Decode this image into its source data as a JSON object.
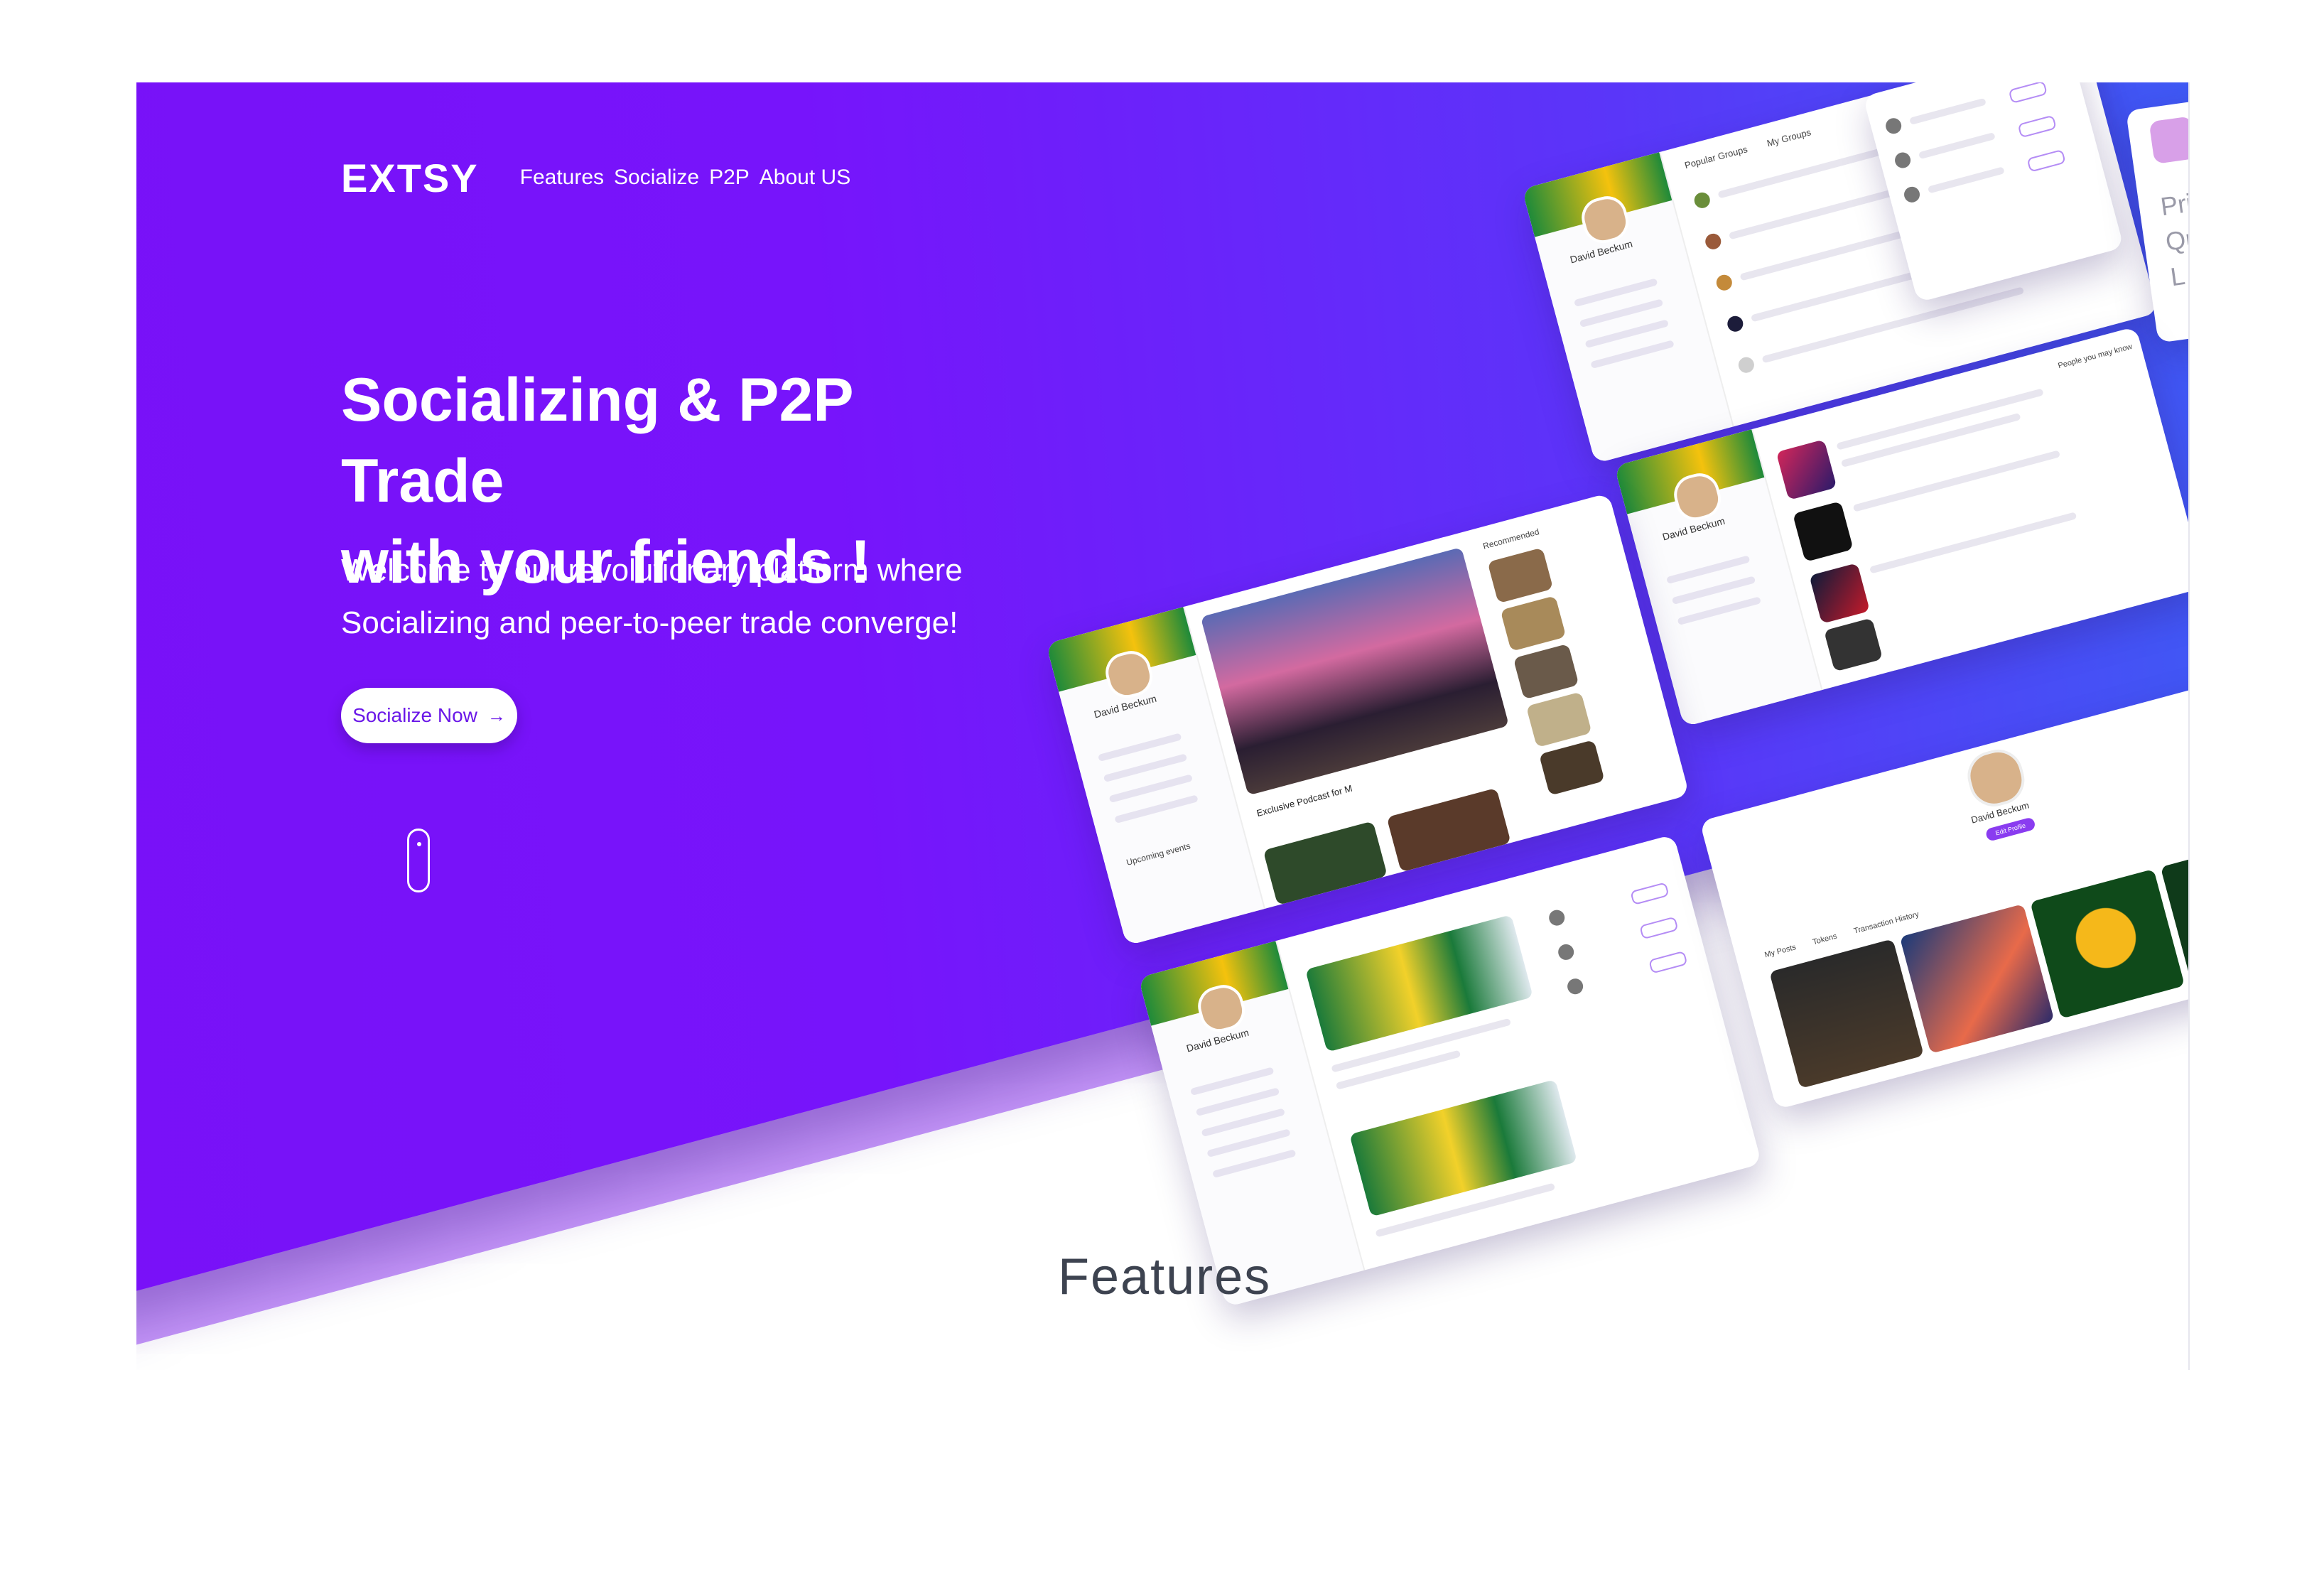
{
  "brand": {
    "logo": "EXTSY"
  },
  "nav": {
    "items": [
      "Features",
      "Socialize",
      "P2P",
      "About US"
    ]
  },
  "hero": {
    "title_line1": "Socializing & P2P Trade",
    "title_line2": "with your friends !",
    "subtitle_line1": "Welcome to our revolutionary platform where",
    "subtitle_line2": "Socializing and peer-to-peer trade converge!",
    "cta_label": "Socialize Now",
    "cta_icon": "arrow-right-icon"
  },
  "mockups": {
    "profile_name": "David Beckum",
    "featured_label": "Exclusive Podcast for M",
    "recommended_label": "Recommended",
    "groups_tabs": [
      "Popular Groups",
      "My Groups"
    ],
    "people_label": "People you may know",
    "upcoming_label": "Upcoming events",
    "edit_profile": "Edit Profile",
    "profile_tabs": [
      "My Posts",
      "Tokens",
      "Transaction History"
    ]
  },
  "partial_card": {
    "line1": "Pric",
    "line2": "Qu",
    "line3": "L"
  },
  "section": {
    "features_heading": "Features"
  },
  "colors": {
    "accent": "#7714fb",
    "gradient_end": "#2f6ef2",
    "cta_text": "#6a17e8"
  }
}
